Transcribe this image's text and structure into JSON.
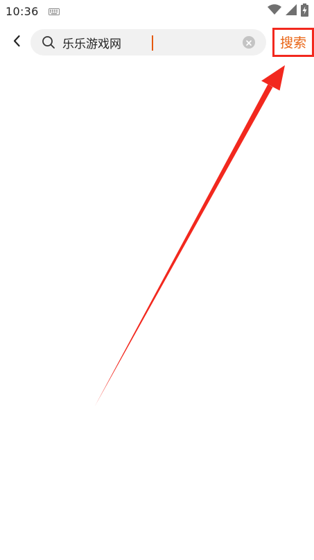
{
  "status_bar": {
    "time": "10:36",
    "icons": [
      "keyboard-icon",
      "wifi-icon",
      "signal-icon",
      "battery-charging-icon"
    ]
  },
  "search": {
    "query": "乐乐游戏网",
    "submit_label": "搜索",
    "icons": [
      "back-arrow-icon",
      "search-icon",
      "clear-icon"
    ]
  },
  "colors": {
    "accent": "#e96414",
    "highlight_annotation": "#f2281e",
    "search_bg": "#f1f1f1"
  }
}
